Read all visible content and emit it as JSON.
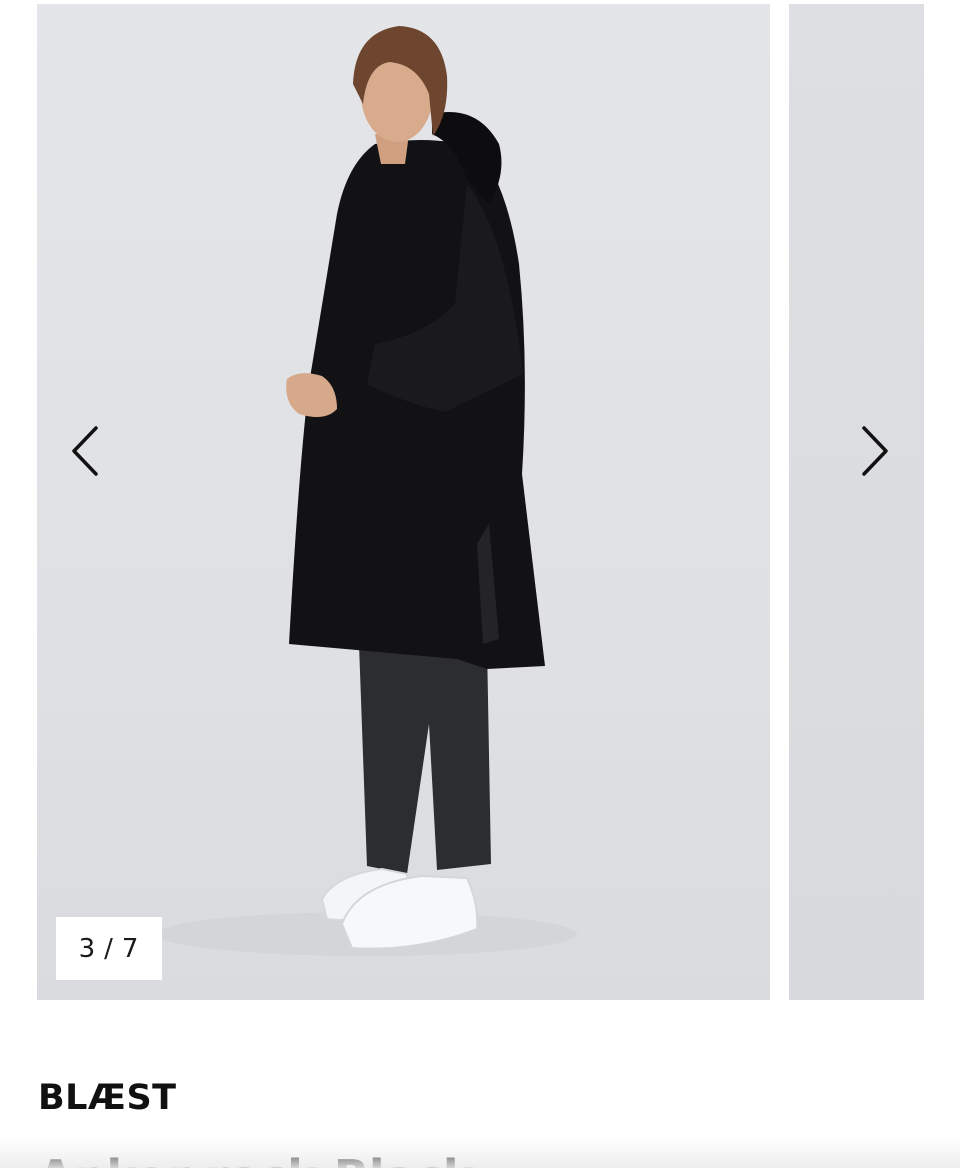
{
  "gallery": {
    "current": "3",
    "total": "7",
    "separator": "/",
    "prev_icon": "chevron-left-icon",
    "next_icon": "chevron-right-icon",
    "image_subject": "Model wearing a black hooded rain poncho, dark jeans and white sneakers"
  },
  "product": {
    "brand": "BLÆST",
    "title": "Anker rock Black"
  },
  "colors": {
    "background": "#ffffff",
    "photo_backdrop": "#e0e2e5",
    "text": "#111111"
  }
}
